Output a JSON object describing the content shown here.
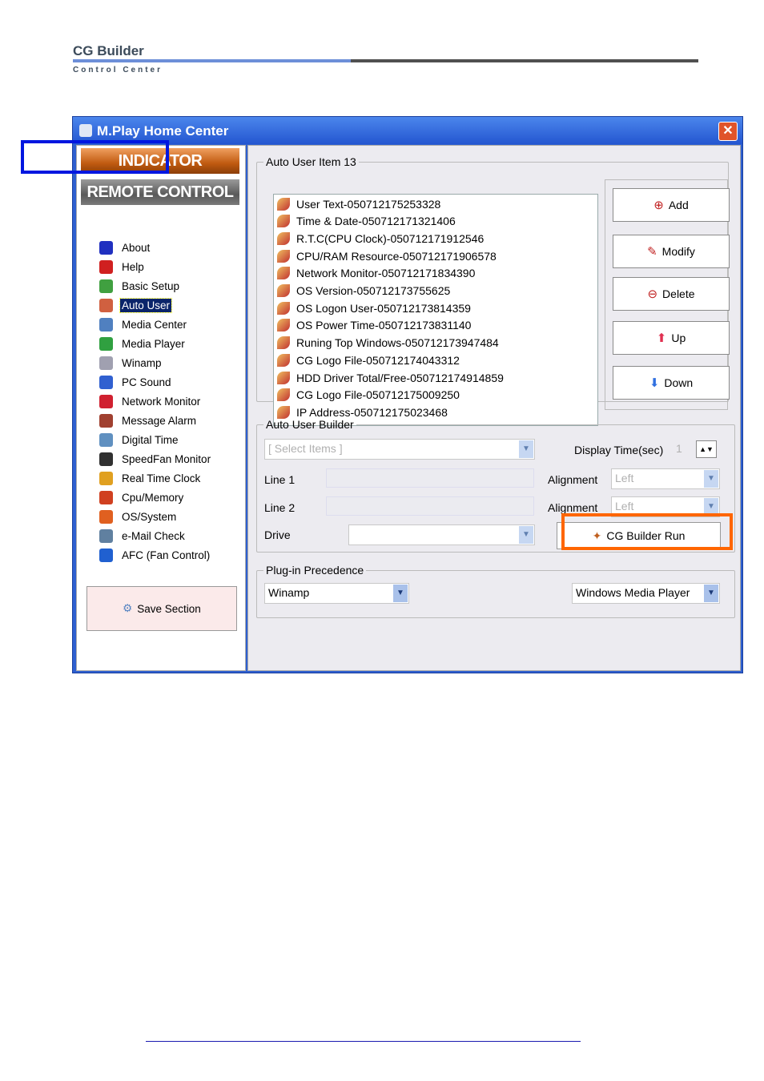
{
  "brand": {
    "title": "CG Builder",
    "subtitle": "Control Center"
  },
  "window": {
    "title": "M.Play Home Center",
    "close": "✕"
  },
  "sidebar": {
    "indicator": "INDICATOR",
    "remote": "REMOTE CONTROL",
    "items": [
      {
        "label": "About",
        "icon": "person-icon",
        "color": "#2030c0"
      },
      {
        "label": "Help",
        "icon": "help-icon",
        "color": "#d02020"
      },
      {
        "label": "Basic Setup",
        "icon": "setup-icon",
        "color": "#40a040"
      },
      {
        "label": "Auto User",
        "icon": "auto-user-icon",
        "color": "#d06040",
        "selected": true
      },
      {
        "label": "Media Center",
        "icon": "media-center-icon",
        "color": "#5080c0"
      },
      {
        "label": "Media Player",
        "icon": "media-player-icon",
        "color": "#30a040"
      },
      {
        "label": "Winamp",
        "icon": "winamp-icon",
        "color": "#a0a0b0"
      },
      {
        "label": "PC Sound",
        "icon": "sound-icon",
        "color": "#3060d0"
      },
      {
        "label": "Network Monitor",
        "icon": "network-icon",
        "color": "#d02030"
      },
      {
        "label": "Message Alarm",
        "icon": "alarm-icon",
        "color": "#a04030"
      },
      {
        "label": "Digital Time",
        "icon": "clock-icon",
        "color": "#6090c0"
      },
      {
        "label": "SpeedFan Monitor",
        "icon": "fan-icon",
        "color": "#303030"
      },
      {
        "label": "Real Time Clock",
        "icon": "rtc-icon",
        "color": "#e0a020"
      },
      {
        "label": "Cpu/Memory",
        "icon": "cpu-icon",
        "color": "#d04020"
      },
      {
        "label": "OS/System",
        "icon": "os-icon",
        "color": "#e06020"
      },
      {
        "label": "e-Mail Check",
        "icon": "mail-icon",
        "color": "#6080a0"
      },
      {
        "label": "AFC (Fan Control)",
        "icon": "afc-icon",
        "color": "#2060d0"
      }
    ],
    "save": "Save Section"
  },
  "items_group": {
    "legend": "Auto User Item 13",
    "items": [
      "User Text-050712175253328",
      "Time & Date-050712171321406",
      "R.T.C(CPU Clock)-050712171912546",
      "CPU/RAM Resource-050712171906578",
      "Network Monitor-050712171834390",
      "OS Version-050712173755625",
      "OS Logon User-050712173814359",
      "OS Power Time-050712173831140",
      "Runing Top Windows-050712173947484",
      "CG Logo File-050712174043312",
      "HDD Driver Total/Free-050712174914859",
      "CG Logo File-050712175009250",
      "IP Address-050712175023468"
    ]
  },
  "buttons": {
    "add": "Add",
    "modify": "Modify",
    "delete": "Delete",
    "up": "Up",
    "down": "Down"
  },
  "builder": {
    "legend": "Auto User Builder",
    "select_placeholder": "[ Select Items ]",
    "display_time_label": "Display Time(sec)",
    "display_time": "1",
    "line1": "Line 1",
    "line2": "Line 2",
    "alignment": "Alignment",
    "align1": "Left",
    "align2": "Left",
    "drive": "Drive",
    "run": "CG Builder Run"
  },
  "plugin": {
    "legend": "Plug-in Precedence",
    "first": "Winamp",
    "second": "Windows Media Player"
  }
}
